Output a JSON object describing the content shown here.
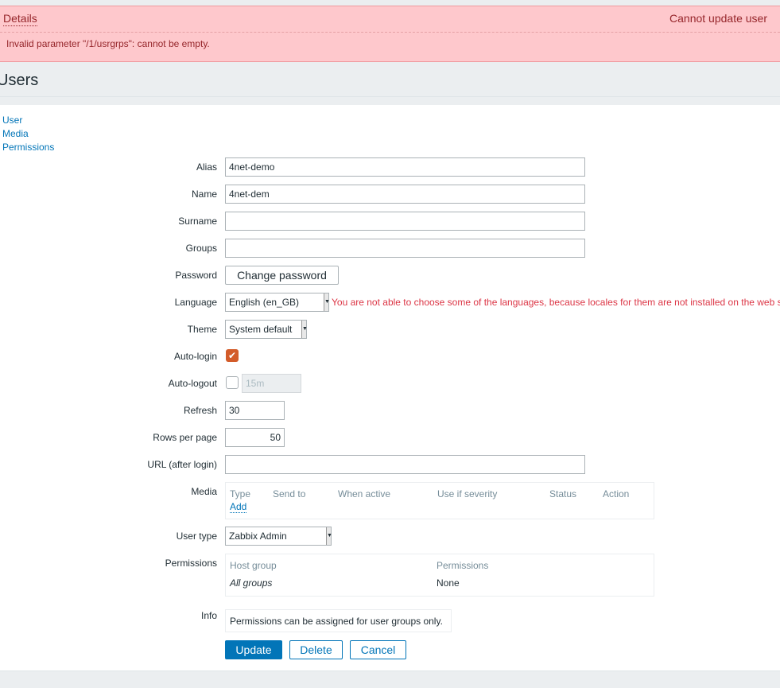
{
  "message": {
    "details_label": "Details",
    "title": "Cannot update user",
    "error": "Invalid parameter \"/1/usrgrps\": cannot be empty."
  },
  "page_title": "Users",
  "tabs": [
    "User",
    "Media",
    "Permissions"
  ],
  "form": {
    "alias": {
      "label": "Alias",
      "value": "4net-demo"
    },
    "name": {
      "label": "Name",
      "value": "4net-dem"
    },
    "surname": {
      "label": "Surname",
      "value": ""
    },
    "groups": {
      "label": "Groups",
      "value": ""
    },
    "password": {
      "label": "Password",
      "button": "Change password"
    },
    "language": {
      "label": "Language",
      "value": "English (en_GB)",
      "warning": "You are not able to choose some of the languages, because locales for them are not installed on the web server."
    },
    "theme": {
      "label": "Theme",
      "value": "System default"
    },
    "autologin": {
      "label": "Auto-login",
      "checked": true
    },
    "autologout": {
      "label": "Auto-logout",
      "checked": false,
      "value": "15m"
    },
    "refresh": {
      "label": "Refresh",
      "value": "30"
    },
    "rows": {
      "label": "Rows per page",
      "value": "50"
    },
    "url": {
      "label": "URL (after login)",
      "value": ""
    },
    "media": {
      "label": "Media",
      "columns": [
        "Type",
        "Send to",
        "When active",
        "Use if severity",
        "Status",
        "Action"
      ],
      "add": "Add"
    },
    "user_type": {
      "label": "User type",
      "value": "Zabbix Admin"
    },
    "permissions": {
      "label": "Permissions",
      "columns": [
        "Host group",
        "Permissions"
      ],
      "row": [
        "All groups",
        "None"
      ]
    },
    "info": {
      "label": "Info",
      "text": "Permissions can be assigned for user groups only."
    }
  },
  "buttons": {
    "update": "Update",
    "delete": "Delete",
    "cancel": "Cancel"
  },
  "colors": {
    "accent": "#0275b8",
    "error_bg": "#fec8cc",
    "error_text": "#96262b",
    "checkbox": "#d35c2a"
  }
}
